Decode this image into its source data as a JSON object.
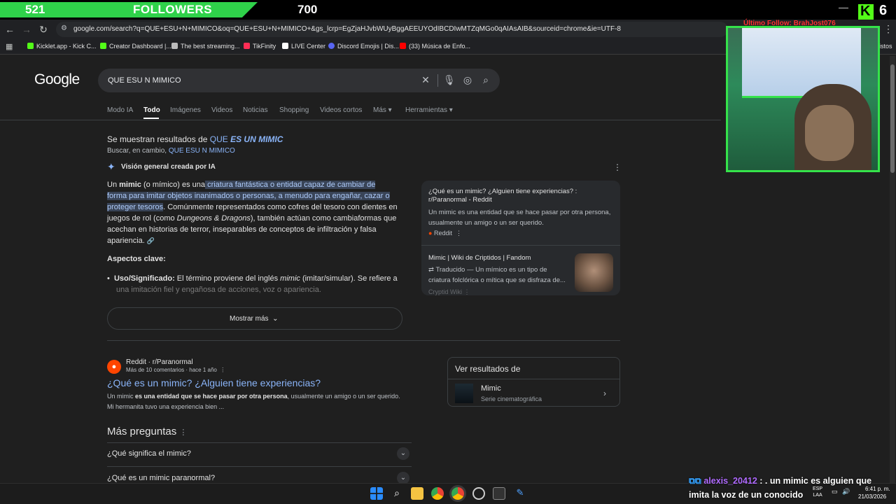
{
  "overlay": {
    "followers_count": "521",
    "followers_label": "FOLLOWERS",
    "followers_goal": "700",
    "kick_count": "6",
    "webcam_label": "Último Follow: BrahJost076"
  },
  "browser": {
    "url": "google.com/search?q=QUE+ESU+N+MIMICO&oq=QUE+ESU+N+MIMICO+&gs_lcrp=EgZjaHJvbWUyBggAEEUYOdIBCDIwMTZqMGo0qAIAsAIB&sourceid=chrome&ie=UTF-8",
    "bookmarks": [
      {
        "label": "Kicklet.app - Kick C...",
        "color": "#53fc18"
      },
      {
        "label": "Creator Dashboard |...",
        "color": "#53fc18"
      },
      {
        "label": "The best streaming...",
        "color": "#bbbbbb"
      },
      {
        "label": "TikFinity",
        "color": "#ff2d55"
      },
      {
        "label": "LIVE Center",
        "color": "#ffffff"
      },
      {
        "label": "Discord Emojis | Dis...",
        "color": "#5865f2"
      },
      {
        "label": "(33) Música de Enfo...",
        "color": "#ff0000"
      }
    ],
    "bookmarks_more": "istos"
  },
  "google": {
    "logo": "Google",
    "query": "QUE ESU N MIMICO",
    "tabs": [
      "Modo IA",
      "Todo",
      "Imágenes",
      "Videos",
      "Noticias",
      "Shopping",
      "Videos cortos",
      "Más ▾",
      "Herramientas ▾"
    ],
    "correction_prefix": "Se muestran resultados de ",
    "correction_a": "QUE ",
    "correction_b": "ES UN MIMIC",
    "instead_prefix": "Buscar, en cambio, ",
    "instead_link": "QUE ESU N MIMICO",
    "ai_title": "Visión general creada por IA",
    "ai_p1_a": "Un ",
    "ai_p1_b": "mimic",
    "ai_p1_c": " (o mímico) es una",
    "ai_hl_1": " criatura fantástica o entidad capaz de cambiar de",
    "ai_hl_2": "forma para imitar objetos inanimados o personas, a menudo para engañar, cazar o",
    "ai_hl_3": "proteger tesoros",
    "ai_p2_a": ". Comúnmente representados como cofres del tesoro con dientes en",
    "ai_p3_a": "juegos de rol (como ",
    "ai_p3_b": "Dungeons & Dragons",
    "ai_p3_c": "), también actúan como cambiaformas que",
    "ai_p4": "acechan en historias de terror, inseparables de conceptos de infiltración y falsa",
    "ai_p5": "apariencia.",
    "aspects_title": "Aspectos clave:",
    "aspect_1_b": "Uso/Significado:",
    "aspect_1_a": " El término proviene del inglés ",
    "aspect_1_i": "mimic",
    "aspect_1_c": " (imitar/simular). Se refiere a",
    "aspect_1_2": "una imitación fiel y engañosa de acciones, voz o apariencia.",
    "show_more": "Mostrar más",
    "source_1_title": "¿Qué es un mimic? ¿Alguien tiene experiencias? :",
    "source_1_title2": "r/Paranormal - Reddit",
    "source_1_snip1": "Un mimic es una entidad que se hace pasar por otra persona,",
    "source_1_snip2": "usualmente un amigo o un ser querido.",
    "source_1_site": "Reddit",
    "source_2_title": "Mimic | Wiki de Criptidos | Fandom",
    "source_2_snip1": "Traducido — Un mímico es un tipo de",
    "source_2_snip2": "criatura folclórica o mítica que se disfraza de...",
    "source_2_site": "Cryptid Wiki",
    "result_site": "Reddit · r/Paranormal",
    "result_meta": "Más de 10 comentarios · hace 1 año",
    "result_title": "¿Qué es un mimic? ¿Alguien tiene experiencias?",
    "result_snip_a": "Un mimic ",
    "result_snip_b": "es una entidad que se hace pasar por otra persona",
    "result_snip_c": ", usualmente un amigo o un ser querido.",
    "result_snip_2": "Mi hermanita tuvo una experiencia bien ...",
    "ver_title": "Ver resultados de",
    "ver_item": "Mimic",
    "ver_sub": "Serie cinematográfica",
    "faq_title": "Más preguntas",
    "faq": [
      "¿Qué significa el mimic?",
      "¿Qué es un mimic paranormal?"
    ]
  },
  "taskbar": {
    "lang1": "ESP",
    "lang2": "LAA",
    "time": "6:41 p. m.",
    "date": "21/03/2026"
  },
  "chat": {
    "user": "alexis_20412",
    "sep": " : ",
    "msg1": ". un mimic es alguien que",
    "msg2": "imita la voz de un conocido"
  }
}
